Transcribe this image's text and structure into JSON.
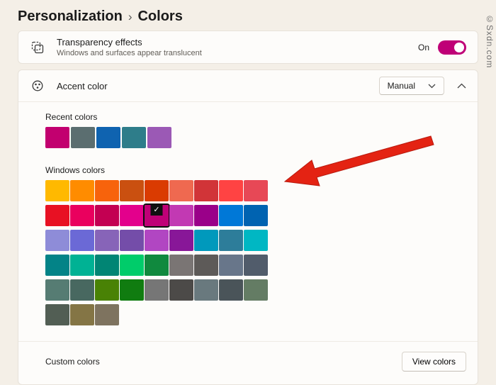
{
  "breadcrumb": {
    "root": "Personalization",
    "separator": "›",
    "current": "Colors"
  },
  "watermark": "©Sxdn.com",
  "transparency": {
    "title": "Transparency effects",
    "subtitle": "Windows and surfaces appear translucent",
    "state_label": "On",
    "toggle_on": true,
    "toggle_color": "#bf0077"
  },
  "accent": {
    "title": "Accent color",
    "dropdown_value": "Manual"
  },
  "recent_colors": {
    "label": "Recent colors",
    "swatches": [
      "#c2006f",
      "#5b6e70",
      "#0f63b0",
      "#2e7d8a",
      "#9b59b5"
    ]
  },
  "windows_colors": {
    "label": "Windows colors",
    "selected_index": 13,
    "check_glyph": "✓",
    "swatches": [
      "#FFB900",
      "#FF8C00",
      "#F7630C",
      "#CA5010",
      "#DA3B01",
      "#EF6950",
      "#D13438",
      "#FF4343",
      "#E74856",
      "#E81123",
      "#EA005E",
      "#C30052",
      "#E3008C",
      "#BF0077",
      "#C239B3",
      "#9A0089",
      "#0078D7",
      "#0063B1",
      "#8E8CD8",
      "#6B69D6",
      "#8764B8",
      "#744DA9",
      "#B146C2",
      "#881798",
      "#0099BC",
      "#2D7D9A",
      "#00B7C3",
      "#038387",
      "#00B294",
      "#018574",
      "#00CC6A",
      "#10893E",
      "#7A7574",
      "#5D5A58",
      "#68768A",
      "#515C6B",
      "#567C73",
      "#486860",
      "#498205",
      "#107C10",
      "#767676",
      "#4C4A48",
      "#69797E",
      "#4A5459",
      "#647C64",
      "#525E54",
      "#847545",
      "#7E735F"
    ]
  },
  "custom_colors": {
    "label": "Custom colors",
    "button_label": "View colors"
  },
  "annotation": {
    "arrow_color": "#e42313",
    "arrow_stroke": "#b91a0e"
  }
}
